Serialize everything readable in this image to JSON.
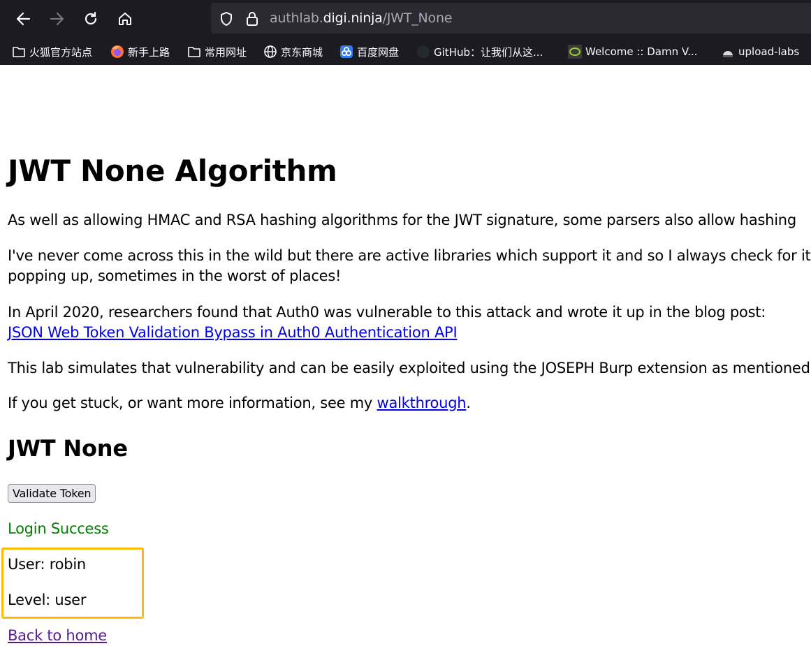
{
  "browser": {
    "url_prefix": "authlab.",
    "url_host": "digi.ninja",
    "url_path": "/JWT_None",
    "bookmarks": [
      {
        "label": "火狐官方站点",
        "icon": "folder-icon"
      },
      {
        "label": "新手上路",
        "icon": "firefox-icon"
      },
      {
        "label": "常用网址",
        "icon": "folder-icon"
      },
      {
        "label": "京东商城",
        "icon": "globe-icon"
      },
      {
        "label": "百度网盘",
        "icon": "baidu-netdisk-icon"
      },
      {
        "label": "GitHub：让我们从这...",
        "icon": "github-icon"
      },
      {
        "label": "Welcome :: Damn V...",
        "icon": "dvwa-icon"
      },
      {
        "label": "upload-labs",
        "icon": "upload-labs-icon"
      }
    ]
  },
  "page": {
    "title": "JWT None Algorithm",
    "para1": "As well as allowing HMAC and RSA hashing algorithms for the JWT signature, some parsers also allow hashing",
    "para2_line1": "I've never come across this in the wild but there are active libraries which support it and so I always check for it",
    "para2_line2": "popping up, sometimes in the worst of places!",
    "para3_line1": "In April 2020, researchers found that Auth0 was vulnerable to this attack and wrote it up in the blog post:",
    "para3_link": "JSON Web Token Validation Bypass in Auth0 Authentication API",
    "para4": "This lab simulates that vulnerability and can be easily exploited using the JOSEPH Burp extension as mentioned",
    "para5_before": "If you get stuck, or want more information, see my ",
    "para5_link": "walkthrough",
    "para5_after": ".",
    "section_title": "JWT None",
    "validate_button": "Validate Token",
    "status": "Login Success",
    "user_line": "User: robin",
    "level_line": "Level: user",
    "back_link": "Back to home"
  },
  "colors": {
    "success": "#008000",
    "link": "#0000ee",
    "visited_link": "#551a8b",
    "highlight_box": "#fbbc05",
    "chrome_bg": "#1c1b22"
  }
}
